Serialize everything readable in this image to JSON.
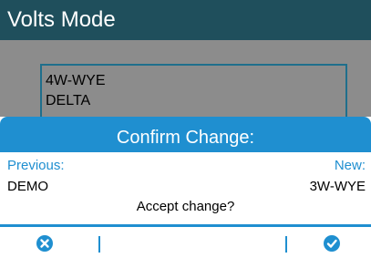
{
  "title": "Volts Mode",
  "mode_list": {
    "options": [
      "4W-WYE",
      "DELTA"
    ]
  },
  "dialog": {
    "title": "Confirm Change:",
    "previous_label": "Previous:",
    "new_label": "New:",
    "previous_value": "DEMO",
    "new_value": "3W-WYE",
    "prompt": "Accept change?"
  },
  "softkeys": {
    "cancel_icon": "close-circle",
    "accept_icon": "check-circle"
  },
  "colors": {
    "accent": "#1f8fd0",
    "title_bar": "#1f4f5c",
    "background_dim": "#8c8c8c"
  }
}
